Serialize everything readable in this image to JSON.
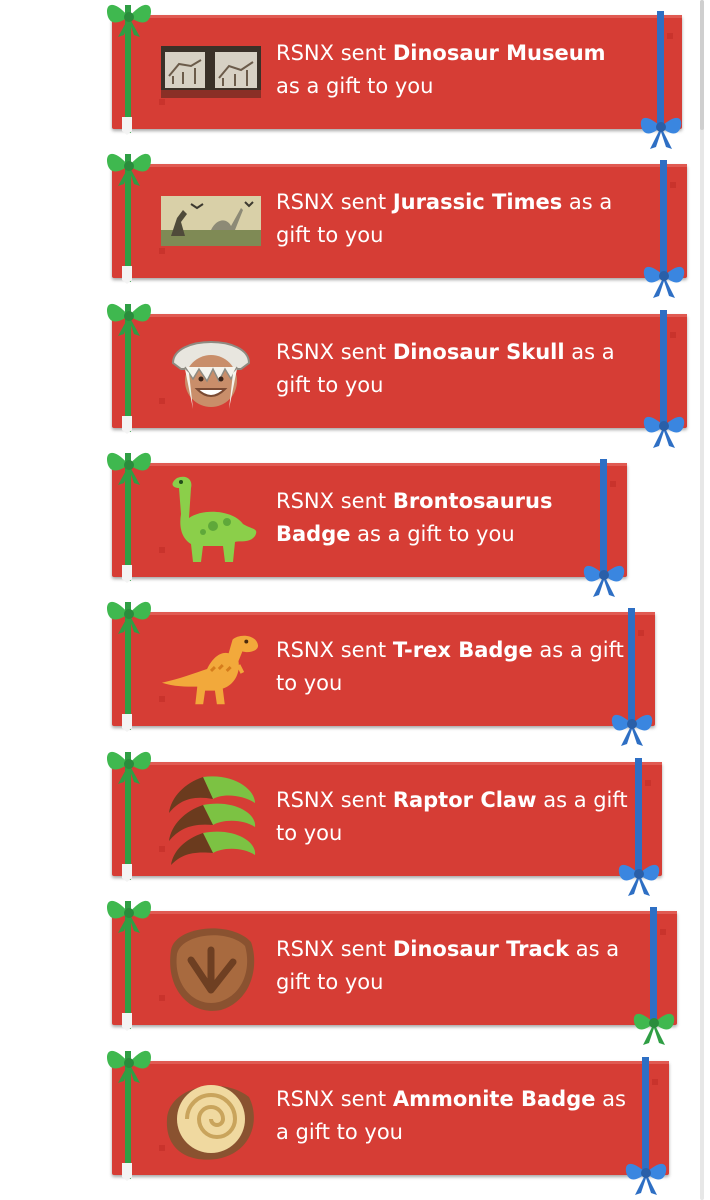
{
  "gifts": [
    {
      "sender": "RSNX",
      "verb": "sent",
      "item": "Dinosaur Museum",
      "suffix": "as a gift to you",
      "icon": "dinosaur-museum-image"
    },
    {
      "sender": "RSNX",
      "verb": "sent",
      "item": "Jurassic Times",
      "suffix": "as a gift to you",
      "icon": "jurassic-times-image"
    },
    {
      "sender": "RSNX",
      "verb": "sent",
      "item": "Dinosaur Skull",
      "suffix": "as a gift to you",
      "icon": "dinosaur-skull-avatar"
    },
    {
      "sender": "RSNX",
      "verb": "sent",
      "item": "Brontosaurus Badge",
      "suffix": "as a gift to you",
      "icon": "brontosaurus-badge-icon"
    },
    {
      "sender": "RSNX",
      "verb": "sent",
      "item": "T-rex Badge",
      "suffix": "as a gift to you",
      "icon": "trex-badge-icon"
    },
    {
      "sender": "RSNX",
      "verb": "sent",
      "item": "Raptor Claw",
      "suffix": "as a gift to you",
      "icon": "raptor-claw-icon"
    },
    {
      "sender": "RSNX",
      "verb": "sent",
      "item": "Dinosaur Track",
      "suffix": "as a gift to you",
      "icon": "dinosaur-track-icon"
    },
    {
      "sender": "RSNX",
      "verb": "sent",
      "item": "Ammonite Badge",
      "suffix": "as a gift to you",
      "icon": "ammonite-badge-icon"
    }
  ],
  "colors": {
    "card": "#d63d35",
    "ribbon_green": "#2f9e44",
    "ribbon_blue": "#2e6fc4",
    "text": "#ffffff"
  }
}
